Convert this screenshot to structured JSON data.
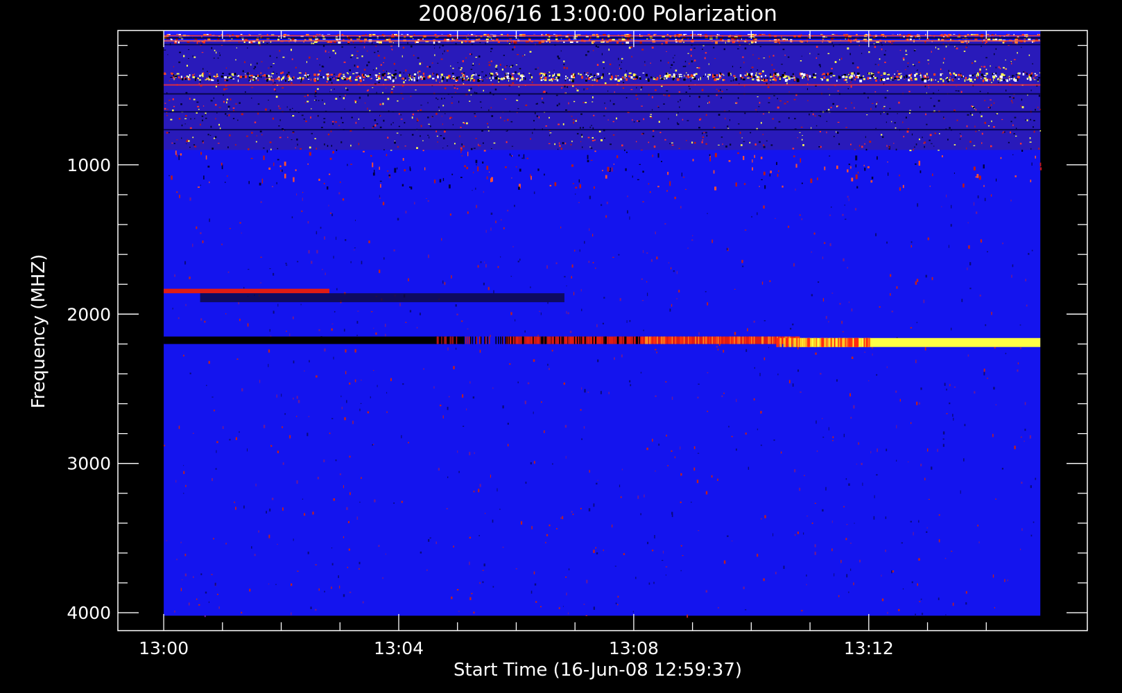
{
  "chart_data": {
    "type": "heatmap",
    "title": "2008/06/16 13:00:00 Polarization",
    "xlabel": "Start Time (16-Jun-08 12:59:37)",
    "ylabel": "Frequency (MHZ)",
    "x_unit": "minutes after 12:59:37",
    "x_data_range": [
      0.38,
      15.3
    ],
    "xlim": [
      -0.4,
      16.1
    ],
    "x_ticks": [
      {
        "value": 0.38,
        "label": "13:00"
      },
      {
        "value": 4.38,
        "label": "13:04"
      },
      {
        "value": 8.38,
        "label": "13:08"
      },
      {
        "value": 12.38,
        "label": "13:12"
      }
    ],
    "x_minor_step_minutes": 1,
    "y_data_range": [
      100,
      4020
    ],
    "ylim": [
      100,
      4120
    ],
    "y_ticks": [
      {
        "value": 1000,
        "label": "1000"
      },
      {
        "value": 2000,
        "label": "2000"
      },
      {
        "value": 3000,
        "label": "3000"
      },
      {
        "value": 4000,
        "label": "4000"
      }
    ],
    "y_minor_step": 200,
    "y_inverted": true,
    "colors": {
      "background": "#000000",
      "baseline": "#1414ee",
      "mid": "#d21818",
      "high": "#ffff55",
      "negative": "#000000"
    },
    "features": [
      {
        "freq_range": [
          110,
          175
        ],
        "time_range": [
          0.38,
          15.3
        ],
        "value": "noisy red/yellow"
      },
      {
        "freq_range": [
          380,
          430
        ],
        "time_range": [
          0.38,
          15.3
        ],
        "value": "bright yellow speckle band"
      },
      {
        "freq_range": [
          175,
          900
        ],
        "time_range": [
          0.38,
          15.3
        ],
        "value": "dark purple noise"
      },
      {
        "freq_range": [
          1070,
          1100
        ],
        "time_range": [
          0.38,
          15.3
        ],
        "value": "red speckles"
      },
      {
        "freq_range": [
          1830,
          1860
        ],
        "time_range": [
          0.38,
          3.2
        ],
        "value": "red"
      },
      {
        "freq_range": [
          1860,
          1920
        ],
        "time_range": [
          1.0,
          7.2
        ],
        "value": "dark"
      },
      {
        "freq_range": [
          2150,
          2200
        ],
        "time_range": [
          0.38,
          5.5
        ],
        "value": "black"
      },
      {
        "freq_range": [
          2150,
          2200
        ],
        "time_range": [
          6.2,
          11.2
        ],
        "value": "red"
      },
      {
        "freq_range": [
          2160,
          2220
        ],
        "time_range": [
          11.2,
          15.3
        ],
        "value": "bright yellow"
      }
    ]
  }
}
